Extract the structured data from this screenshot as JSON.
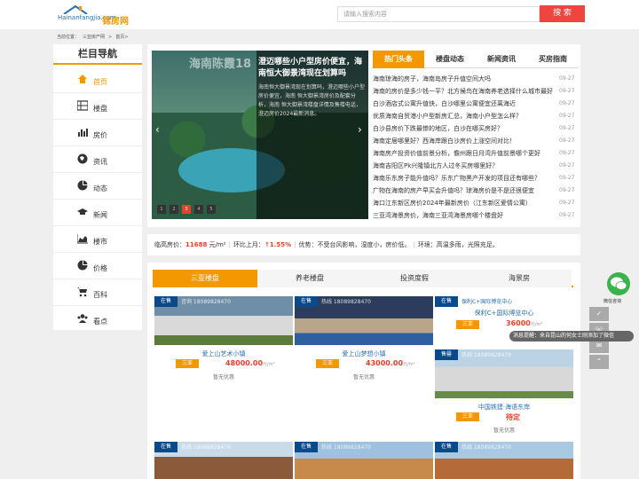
{
  "header": {
    "logo_url": "Hainanfangjia.com",
    "logo_name": "锦房网",
    "search_placeholder": "请输入搜索内容",
    "search_button": "搜 索"
  },
  "breadcrumb": [
    "当前位置：",
    "三亚房产网",
    ">",
    "首页>"
  ],
  "leftnav": {
    "title": "栏目导航",
    "items": [
      {
        "label": "首页",
        "icon": "home-icon"
      },
      {
        "label": "楼盘",
        "icon": "grid-icon"
      },
      {
        "label": "房价",
        "icon": "bar-chart-icon"
      },
      {
        "label": "资讯",
        "icon": "globe-icon"
      },
      {
        "label": "动态",
        "icon": "pie-chart-icon"
      },
      {
        "label": "新闻",
        "icon": "graduation-cap-icon"
      },
      {
        "label": "楼市",
        "icon": "area-chart-icon"
      },
      {
        "label": "价格",
        "icon": "pie-chart-icon"
      },
      {
        "label": "百科",
        "icon": "cart-icon"
      },
      {
        "label": "看点",
        "icon": "users-icon"
      }
    ]
  },
  "slider": {
    "watermark": "海南陈霞18",
    "title": "澄迈哪些小户型房价便宜，海南恒大御景湾现在划算吗",
    "desc": "海南恒大御景湾现在划算吗，澄迈哪些小户型房价便宜，海南 恒大御景湾房价及配套分析，海南 恒大御景湾楼盘详情及售楼电话，澄迈房价2024最新消息。",
    "prev": "‹",
    "next": "›",
    "dots": [
      "1",
      "2",
      "3",
      "4",
      "5"
    ]
  },
  "news": {
    "tabs": [
      "热门头条",
      "楼盘动态",
      "新闻资讯",
      "买房指南"
    ],
    "items": [
      {
        "title": "海南琼海的房子，海南岛房子升值空间大吗",
        "date": "09-27"
      },
      {
        "title": "海南的房价是多少钱一平？北方候鸟在海南养老选择什么城市最好",
        "date": "09-27"
      },
      {
        "title": "白沙酒店式公寓升值快，白沙哪里公寓便宜还离海近",
        "date": "09-27"
      },
      {
        "title": "优质海南自贸港小户型新房汇总，海南小户型怎么样？",
        "date": "09-27"
      },
      {
        "title": "白沙县房价下跌最惨的地区，白沙在哪买房好？",
        "date": "09-27"
      },
      {
        "title": "海南定居哪里好？西海岸跟白沙房价上涨空间对比！",
        "date": "09-27"
      },
      {
        "title": "海南房产投资价值前景分析，儋州跟日月湾升值前景哪个更好",
        "date": "09-27"
      },
      {
        "title": "海南吉阳区Pk兴隆镇北方人过冬买房哪里好？",
        "date": "09-27"
      },
      {
        "title": "海南乐东房子能升值吗？乐东广物黑产开发的项目还有哪些？",
        "date": "09-27"
      },
      {
        "title": "广物在海南的房产早买会升值吗？琼海房价是不是还很便宜",
        "date": "09-27"
      },
      {
        "title": "海口江东新区房价2024年最新房价（江东新区爱情公寓）",
        "date": "09-27"
      },
      {
        "title": "三亚湾海景房价，海南三亚湾海景房哪个楼盘好",
        "date": "09-27"
      }
    ]
  },
  "infobar": {
    "price_label": "临高房价：",
    "price_value": "11688",
    "price_unit": "元/m²",
    "change_label": "环比上月：",
    "change_value": "↑1.55%",
    "advantage": "优势：不受台风影响，湿度小，房价低。",
    "environment": "环境：高温多雨，光照充足。"
  },
  "listing": {
    "tabs": [
      "三亚楼盘",
      "养老楼盘",
      "投资度假",
      "海景房"
    ],
    "cards": [
      {
        "badge": "在售",
        "phone": "咨询 18089828470",
        "name": "爱上山艺术小镇",
        "tag": "三亚",
        "price": "48000.00",
        "unit": "元/m²",
        "promo": "暂无优惠"
      },
      {
        "badge": "在售",
        "phone": "热线 18089828470",
        "name": "爱上山梦想小镇",
        "tag": "三亚",
        "price": "43000.00",
        "unit": "元/m²",
        "promo": "暂无优惠"
      },
      {
        "badge": "在售",
        "phone": "保利C+国际博览中心",
        "name": "保利C+国际博览中心",
        "tag": "三亚",
        "price": "36000",
        "unit": "元/m²",
        "promo": ""
      },
      {
        "badge": "售罄",
        "phone": "热线 18089828470",
        "name": "中国铁建·海语东岸",
        "tag": "三亚",
        "price": "待定",
        "unit": "",
        "promo": "暂无优惠"
      },
      {
        "badge": "在售",
        "phone": "热线 18089828470",
        "name": "",
        "tag": "",
        "price": "",
        "unit": "",
        "promo": ""
      },
      {
        "badge": "在售",
        "phone": "热线 18089828470",
        "name": "",
        "tag": "",
        "price": "",
        "unit": "",
        "promo": ""
      },
      {
        "badge": "在售",
        "phone": "热线 18089828470",
        "name": "",
        "tag": "",
        "price": "",
        "unit": "",
        "promo": ""
      }
    ]
  },
  "side": {
    "wechat_label": "微信咨询",
    "toast": "消息提醒：来自昆山的何女士刚添加了微信"
  }
}
